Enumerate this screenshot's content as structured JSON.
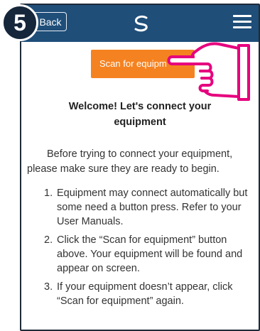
{
  "step_badge": "5",
  "header": {
    "back_label": "Back",
    "logo_icon": "swirl-logo-icon",
    "menu_icon": "hamburger-menu-icon"
  },
  "scan_button_label": "Scan for equipm",
  "welcome": {
    "line1": "Welcome! Let's connect your",
    "line2": "equipment"
  },
  "intro_text": "Before trying to connect your equipment, please make sure they are ready to begin.",
  "steps": [
    {
      "num": "1.",
      "text": "Equipment may connect automatically but some need a button press. Refer to your User Manuals."
    },
    {
      "num": "2.",
      "text": "Click the “Scan for equipment” button above. Your equipment will be found and appear on screen."
    },
    {
      "num": "3.",
      "text": "If your equipment doesn’t appear, click “Scan for equipment” again."
    }
  ],
  "colors": {
    "header_bg": "#1f4e79",
    "scan_button_bg": "#f58220",
    "badge_bg": "#16263b",
    "pointer_hand": "#e6007e"
  }
}
